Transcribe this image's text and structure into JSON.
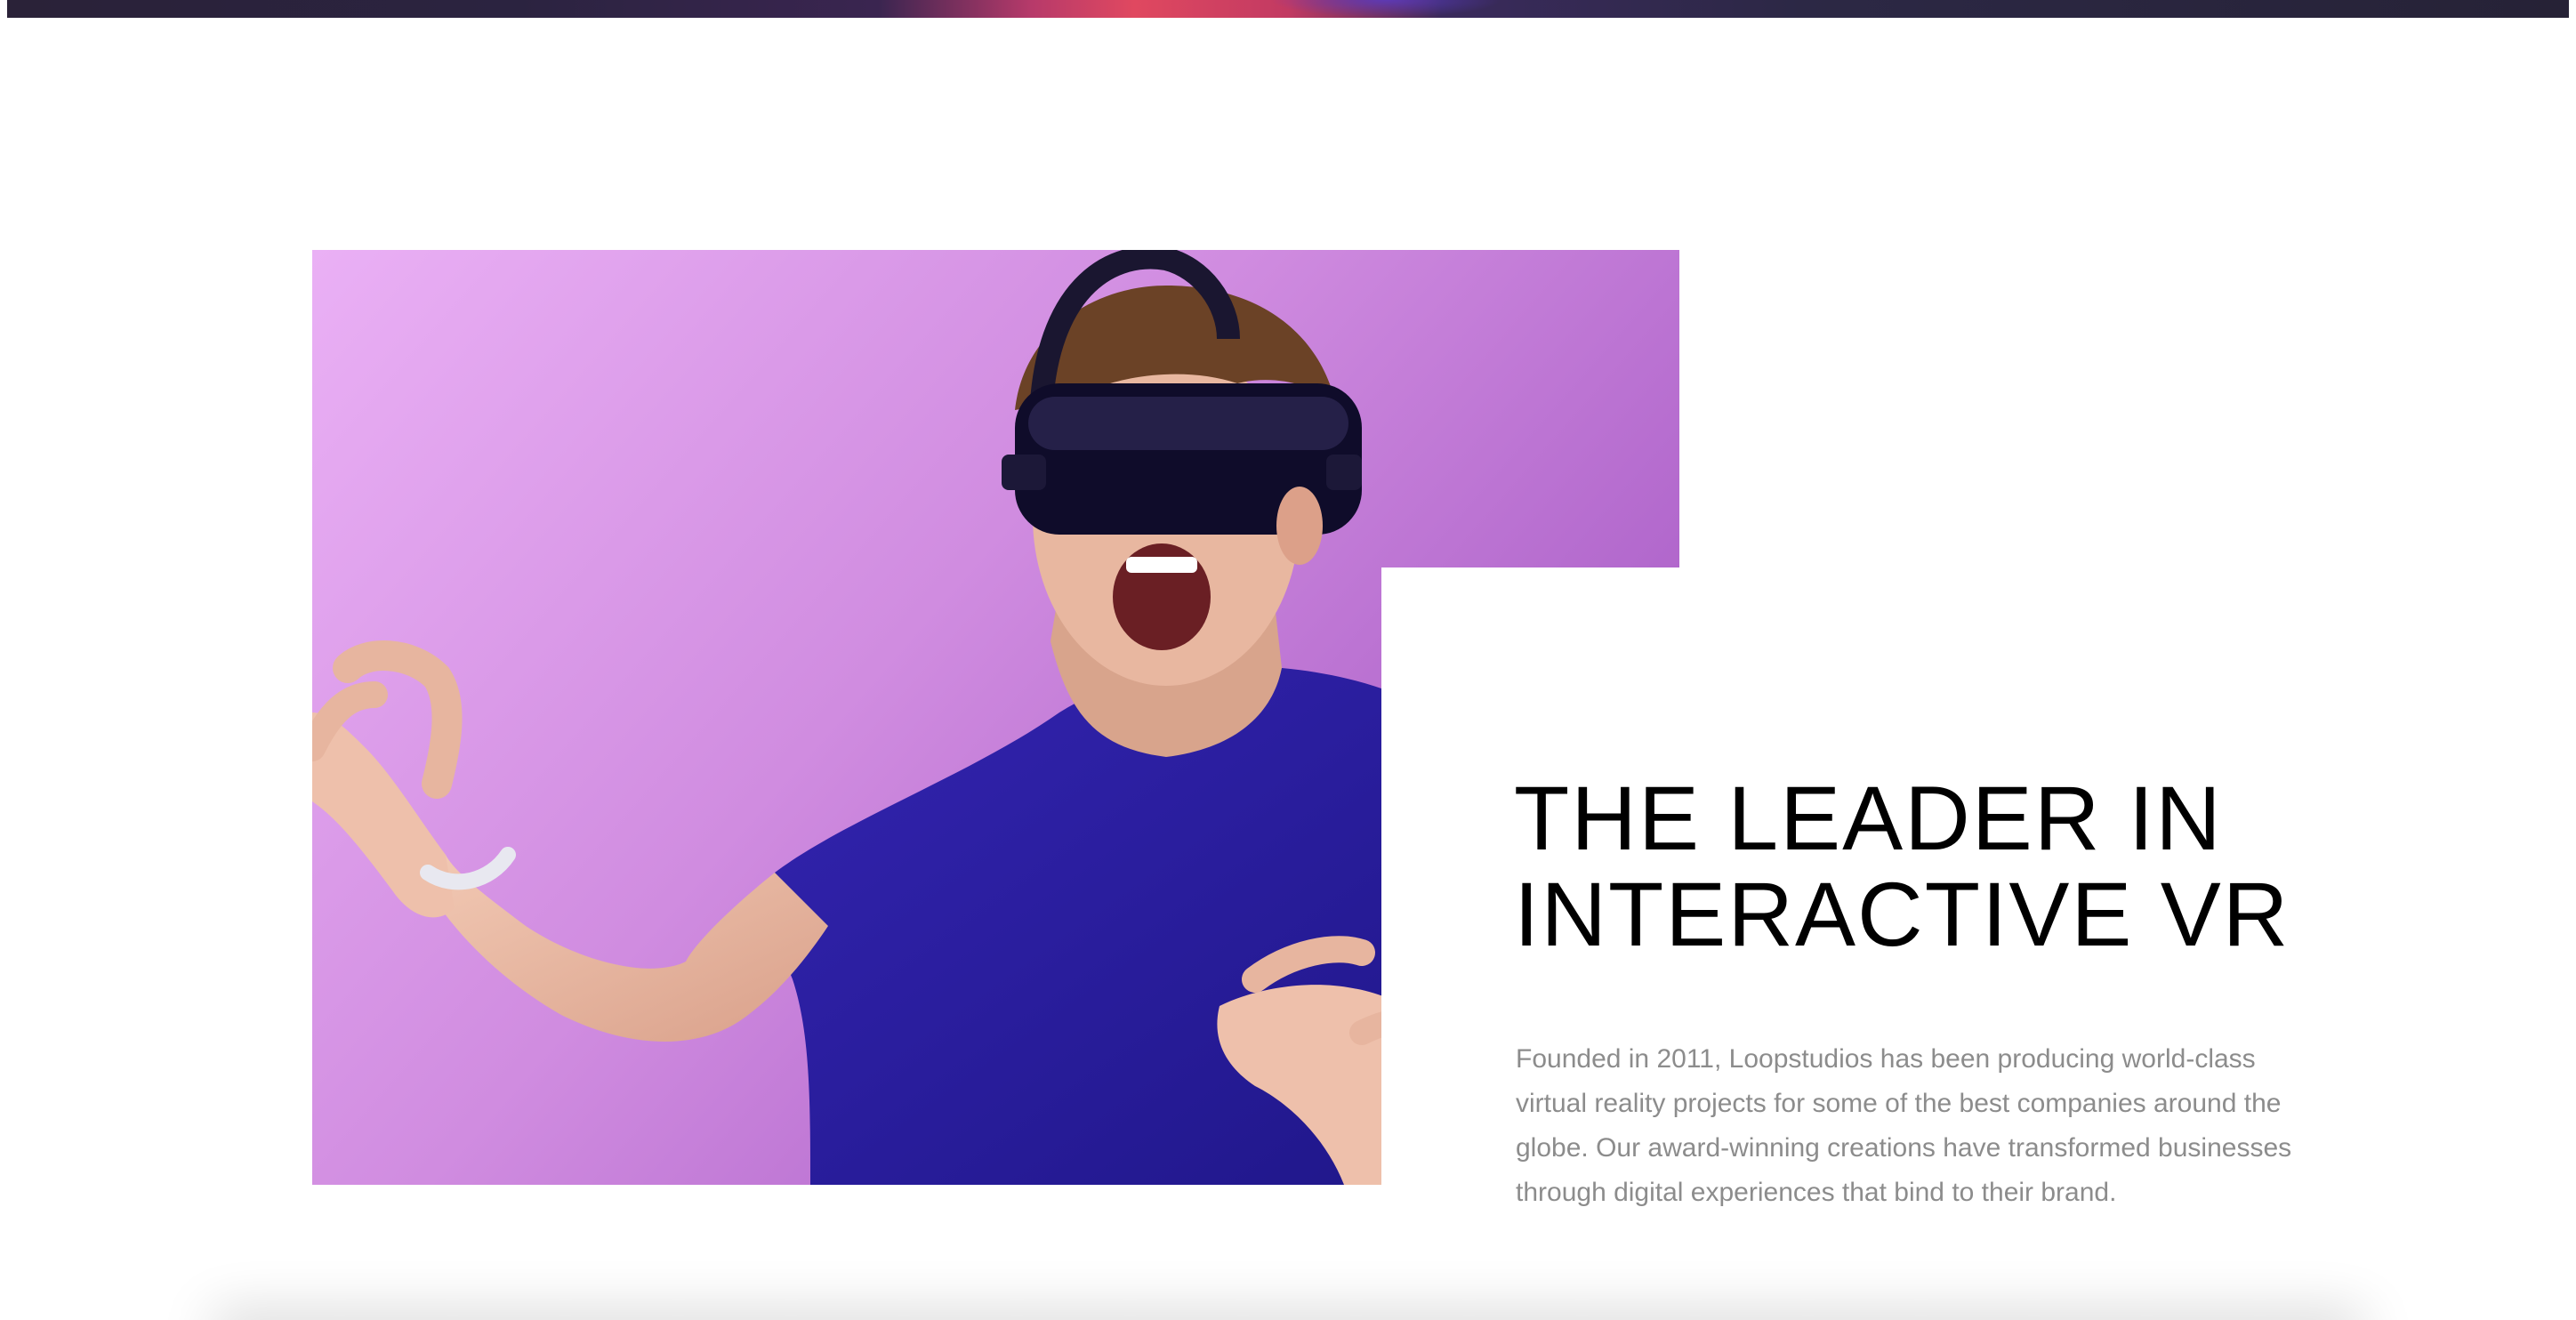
{
  "colors": {
    "background": "#ffffff",
    "heading": "#000000",
    "body_text": "#8c8c8c",
    "photo_bg_light": "#eaaaf2",
    "photo_bg_dark": "#a85cc6",
    "shirt": "#2a1f9e"
  },
  "hero": {
    "image_name": "hero-image-bottom-edge"
  },
  "about": {
    "image_name": "man-wearing-vr-headset",
    "heading_line1": "THE LEADER IN",
    "heading_line2": "INTERACTIVE VR",
    "body": "Founded in 2011, Loopstudios has been producing world-class virtual reality projects for some of the best companies around the globe. Our award-winning creations have transformed businesses through digital experiences that bind to their brand."
  }
}
